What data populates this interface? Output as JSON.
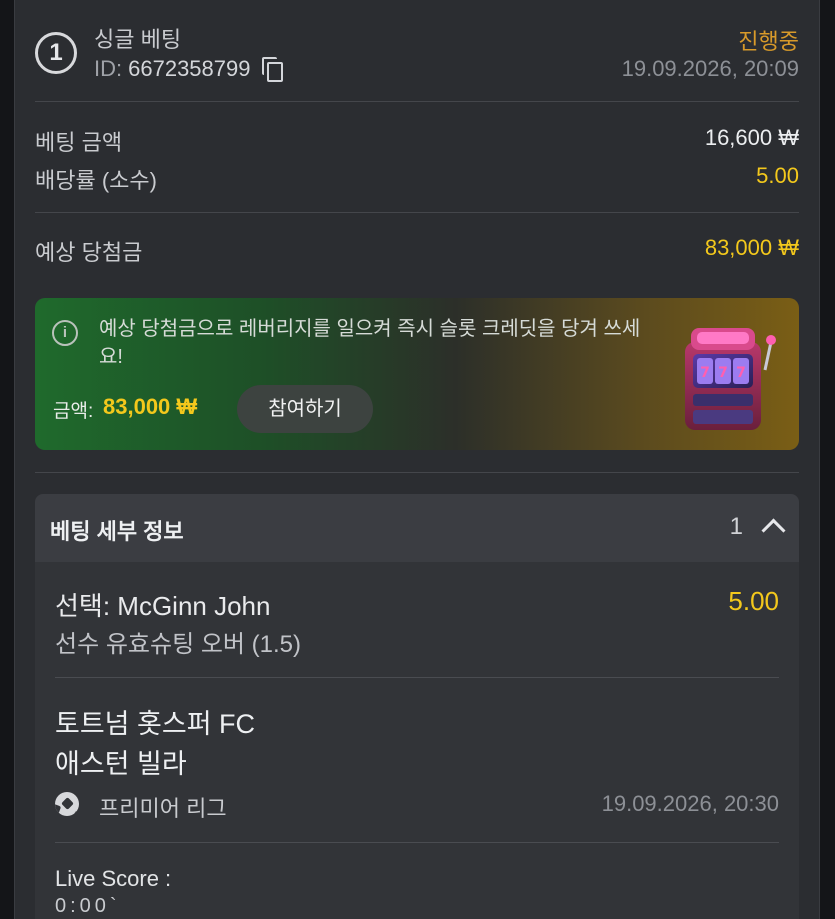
{
  "bet": {
    "number": "1",
    "type": "싱글 베팅",
    "id_label": "ID:",
    "id_value": "6672358799",
    "status": "진행중",
    "datetime": "19.09.2026, 20:09"
  },
  "summary": {
    "stake_label": "베팅 금액",
    "stake_value": "16,600 ₩",
    "odds_label": "배당률 (소수)",
    "odds_value": "5.00",
    "potential_label": "예상 당첨금",
    "potential_value": "83,000 ₩"
  },
  "promo": {
    "message": "예상 당첨금으로 레버리지를 일으켜 즉시 슬롯 크레딧을 당겨 쓰세요!",
    "amount_label": "금액:",
    "amount_value": "83,000 ₩",
    "button_label": "참여하기"
  },
  "details": {
    "title": "베팅 세부 정보",
    "count": "1",
    "selection": "선택: McGinn John",
    "selection_odds": "5.00",
    "market": "선수 유효슈팅 오버 (1.5)",
    "home_team": "토트넘 홋스퍼 FC",
    "away_team": "애스턴 빌라",
    "league": "프리미어 리그",
    "match_datetime": "19.09.2026, 20:30",
    "live_score_label": "Live Score :",
    "live_score_value": "0:00`"
  },
  "colors": {
    "accent_yellow": "#f3c81c",
    "status_orange": "#d89a2a",
    "card_bg": "#2b2d31"
  }
}
